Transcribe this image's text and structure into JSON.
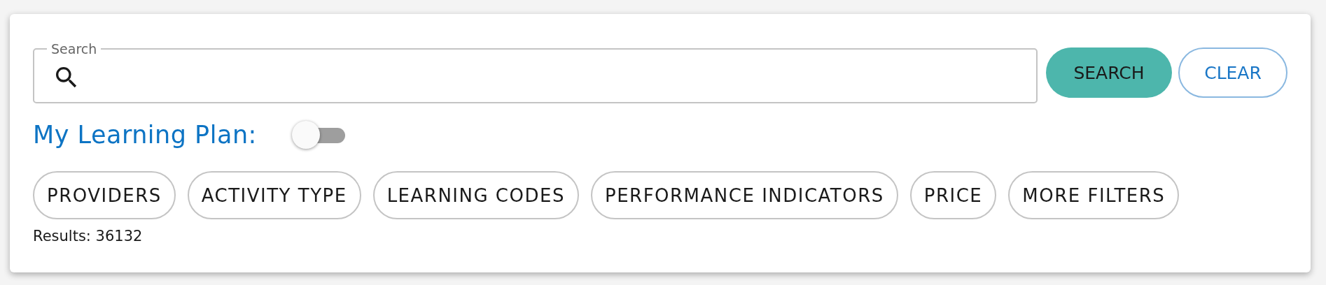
{
  "search": {
    "label": "Search"
  },
  "buttons": [
    {
      "kind": "primary",
      "label": "SEARCH"
    },
    {
      "kind": "outline",
      "label": "CLEAR"
    }
  ],
  "learning_plan": {
    "label": "My Learning Plan:",
    "on": false
  },
  "filters": [
    "PROVIDERS",
    "ACTIVITY TYPE",
    "LEARNING CODES",
    "PERFORMANCE INDICATORS",
    "PRICE",
    "MORE FILTERS"
  ],
  "results": "Results: 36132"
}
